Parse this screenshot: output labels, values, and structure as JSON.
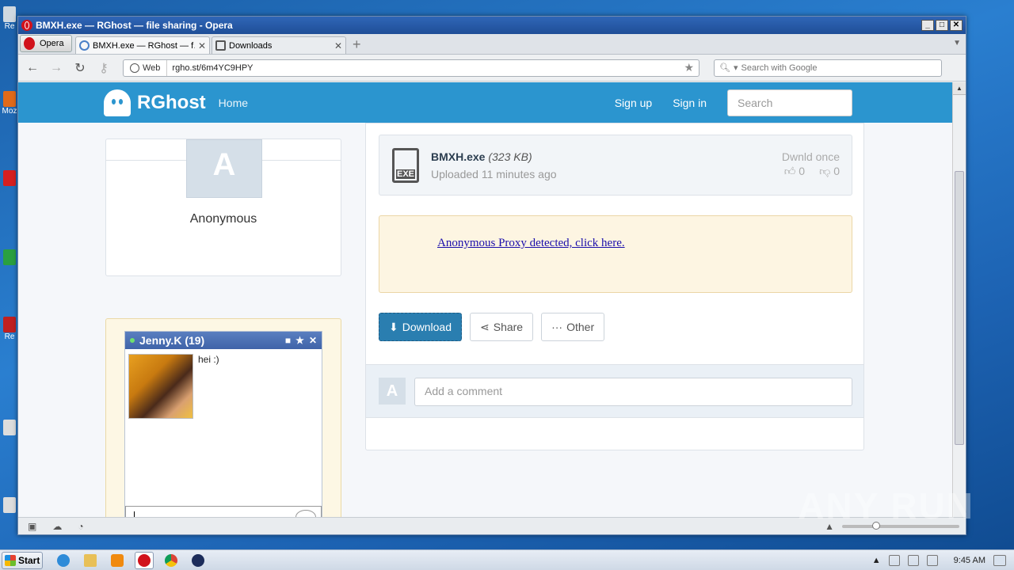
{
  "window": {
    "title": "BMXH.exe — RGhost — file sharing - Opera"
  },
  "browser": {
    "menu_label": "Opera",
    "tabs": [
      {
        "label": "BMXH.exe — RGhost — f…",
        "active": true
      },
      {
        "label": "Downloads",
        "active": false
      }
    ],
    "url_scheme_label": "Web",
    "url": "rgho.st/6m4YC9HPY",
    "search_placeholder": "Search with Google"
  },
  "site": {
    "brand": "RGhost",
    "nav_home": "Home",
    "sign_up": "Sign up",
    "sign_in": "Sign in",
    "search_placeholder": "Search",
    "accent": "#2b95cf"
  },
  "uploader": {
    "avatar_letter": "A",
    "name": "Anonymous"
  },
  "chat_ad": {
    "name": "Jenny.K (19)",
    "message": "hei :)"
  },
  "file": {
    "name": "BMXH.exe",
    "size": "(323 KB)",
    "uploaded": "Uploaded 11 minutes ago",
    "downloads": "Dwnld once",
    "likes": "0",
    "dislikes": "0",
    "icon_label": "EXE"
  },
  "proxy_notice": "Anonymous Proxy detected, click here.",
  "actions": {
    "download": "Download",
    "share": "Share",
    "other": "Other"
  },
  "comment": {
    "avatar_letter": "A",
    "placeholder": "Add a comment"
  },
  "taskbar": {
    "start": "Start",
    "clock": "9:45 AM"
  },
  "watermark": "ANY RUN"
}
